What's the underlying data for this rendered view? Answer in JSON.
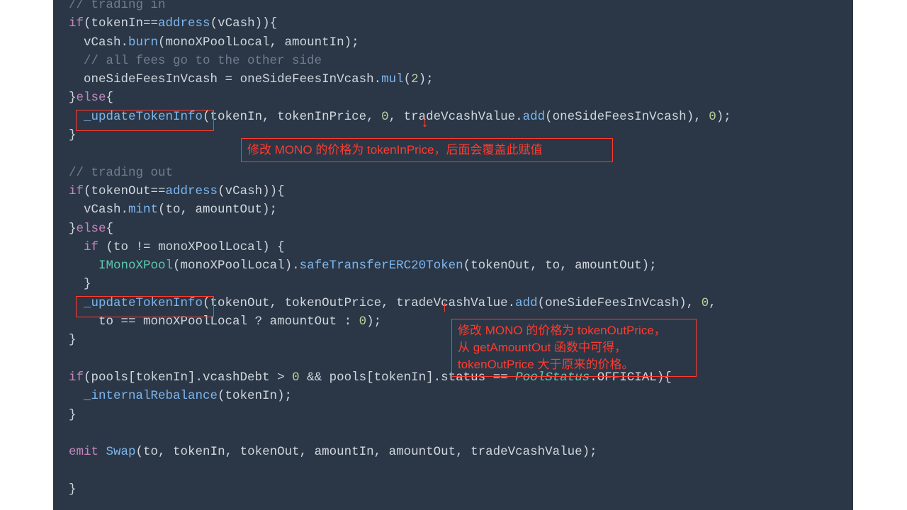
{
  "code": {
    "l1": "// trading in",
    "l2a": "if",
    "l2b": "(tokenIn",
    "l2c": "==",
    "l2d": "address",
    "l2e": "(vCash)){",
    "l3a": "  vCash.",
    "l3b": "burn",
    "l3c": "(monoXPoolLocal, amountIn);",
    "l4": "  // all fees go to the other side",
    "l5a": "  oneSideFeesInVcash ",
    "l5b": "=",
    "l5c": " oneSideFeesInVcash.",
    "l5d": "mul",
    "l5e": "(",
    "l5f": "2",
    "l5g": ");",
    "l6a": "}",
    "l6b": "else",
    "l6c": "{",
    "l7a": "  ",
    "l7b": "_updateTokenInfo",
    "l7c": "(tokenIn, tokenInPrice, ",
    "l7d": "0",
    "l7e": ", tradeVcashValue.",
    "l7f": "add",
    "l7g": "(oneSideFeesInVcash), ",
    "l7h": "0",
    "l7i": ");",
    "l8": "}",
    "l9": "",
    "l10": "// trading out",
    "l11a": "if",
    "l11b": "(tokenOut",
    "l11c": "==",
    "l11d": "address",
    "l11e": "(vCash)){",
    "l12a": "  vCash.",
    "l12b": "mint",
    "l12c": "(to, amountOut);",
    "l13a": "}",
    "l13b": "else",
    "l13c": "{",
    "l14a": "  ",
    "l14b": "if",
    "l14c": " (to ",
    "l14d": "!=",
    "l14e": " monoXPoolLocal) {",
    "l15a": "    ",
    "l15b": "IMonoXPool",
    "l15c": "(monoXPoolLocal).",
    "l15d": "safeTransferERC20Token",
    "l15e": "(tokenOut, to, amountOut);",
    "l16": "  }",
    "l17a": "  ",
    "l17b": "_updateTokenInfo",
    "l17c": "(tokenOut, tokenOutPrice, tradeVcashValue.",
    "l17d": "add",
    "l17e": "(oneSideFeesInVcash), ",
    "l17f": "0",
    "l17g": ",",
    "l18a": "    to ",
    "l18b": "==",
    "l18c": " monoXPoolLocal ",
    "l18d": "?",
    "l18e": " amountOut ",
    "l18f": ":",
    "l18g": " ",
    "l18h": "0",
    "l18i": ");",
    "l19": "}",
    "l20": "",
    "l21a": "if",
    "l21b": "(pools[tokenIn].vcashDebt ",
    "l21c": ">",
    "l21d": " ",
    "l21e": "0",
    "l21f": " ",
    "l21g": "&&",
    "l21h": " pools[tokenIn].status ",
    "l21i": "==",
    "l21j": " ",
    "l21k": "PoolStatus",
    "l21l": ".OFFICIAL){",
    "l22a": "  ",
    "l22b": "_internalRebalance",
    "l22c": "(tokenIn);",
    "l23": "}",
    "l24": "",
    "l25a": "emit",
    "l25b": " ",
    "l25c": "Swap",
    "l25d": "(to, tokenIn, tokenOut, amountIn, amountOut, tradeVcashValue);",
    "l26": "",
    "l27": "}"
  },
  "annotations": {
    "a1": "修改 MONO 的价格为 tokenInPrice，后面会覆盖此赋值",
    "a2_l1": "修改 MONO 的价格为 tokenOutPrice，",
    "a2_l2": "从 getAmountOut 函数中可得，",
    "a2_l3": "tokenOutPrice 大于原来的价格。"
  },
  "arrows": {
    "down": "↓",
    "up": "↑"
  }
}
